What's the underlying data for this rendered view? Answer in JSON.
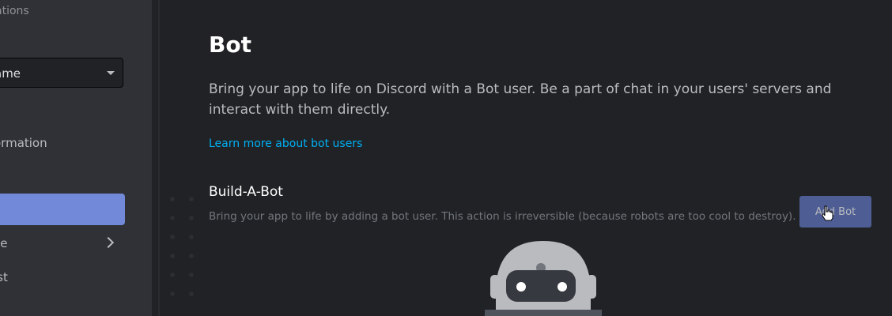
{
  "sidebar": {
    "heading": "ations",
    "select_value": "ame",
    "items": [
      {
        "label": "ormation",
        "active": false
      },
      {
        "label": "",
        "active": true
      },
      {
        "label": "ce",
        "active": false
      },
      {
        "label": "ist",
        "active": false
      }
    ]
  },
  "main": {
    "title": "Bot",
    "description": "Bring your app to life on Discord with a Bot user. Be a part of chat in your users' servers and interact with them directly.",
    "learn_link": "Learn more about bot users",
    "section_title": "Build-A-Bot",
    "section_description": "Bring your app to life by adding a bot user. This action is irreversible (because robots are too cool to destroy).",
    "add_button": "Add Bot"
  },
  "colors": {
    "background": "#202225",
    "sidebar": "#2f3136",
    "active_item": "#7289da",
    "button": "#4e5d94",
    "link": "#00b0f4"
  }
}
